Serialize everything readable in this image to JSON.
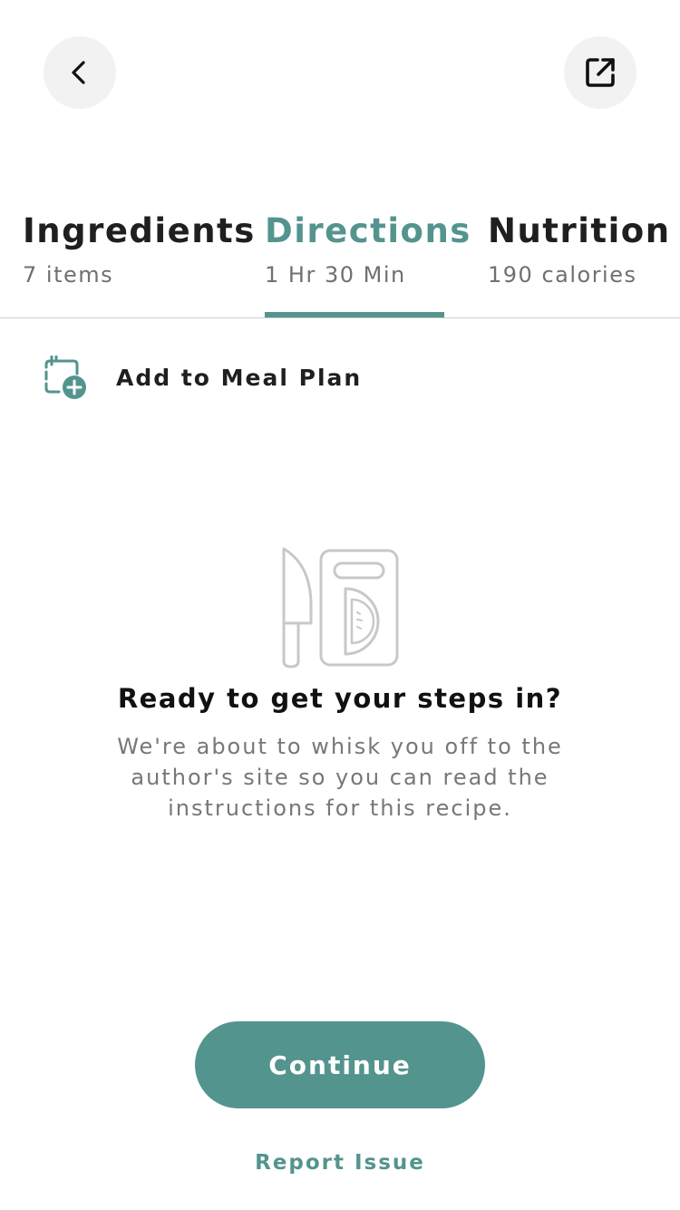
{
  "header": {
    "back_icon": "chevron-left-icon",
    "share_icon": "external-link-icon"
  },
  "tabs": [
    {
      "title": "Ingredients",
      "subtitle": "7 items",
      "active": false
    },
    {
      "title": "Directions",
      "subtitle": "1 Hr 30 Min",
      "active": true
    },
    {
      "title": "Nutrition",
      "subtitle": "190 calories",
      "active": false
    }
  ],
  "meal_plan": {
    "icon": "calendar-add-icon",
    "label": "Add to Meal Plan"
  },
  "empty_state": {
    "illustration": "knife-and-cutting-board-icon",
    "title": "Ready to get your steps in?",
    "body": "We're about to whisk you off to the author's site so you can read the instructions for this recipe."
  },
  "actions": {
    "continue_label": "Continue",
    "report_label": "Report Issue"
  },
  "colors": {
    "accent": "#54948e",
    "text": "#1f1f1f",
    "muted": "#777777",
    "icon_bg": "#f2f2f2"
  }
}
